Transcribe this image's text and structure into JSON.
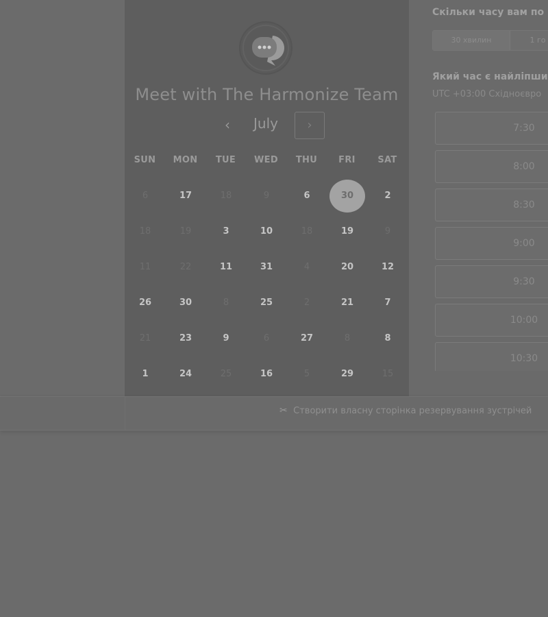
{
  "title": "Meet with The Harmonize Team",
  "calendar": {
    "month": "July",
    "prev_icon": "‹",
    "next_icon": "›",
    "weekdays": [
      "SUN",
      "MON",
      "TUE",
      "WED",
      "THU",
      "FRI",
      "SAT"
    ],
    "weeks": [
      [
        {
          "d": "6",
          "a": false
        },
        {
          "d": "17",
          "a": true
        },
        {
          "d": "18",
          "a": false
        },
        {
          "d": "9",
          "a": false
        },
        {
          "d": "6",
          "a": true
        },
        {
          "d": "30",
          "a": true,
          "s": true
        },
        {
          "d": "2",
          "a": true
        }
      ],
      [
        {
          "d": "18",
          "a": false
        },
        {
          "d": "19",
          "a": false
        },
        {
          "d": "3",
          "a": true
        },
        {
          "d": "10",
          "a": true
        },
        {
          "d": "18",
          "a": false
        },
        {
          "d": "19",
          "a": true
        },
        {
          "d": "9",
          "a": false
        }
      ],
      [
        {
          "d": "11",
          "a": false
        },
        {
          "d": "22",
          "a": false
        },
        {
          "d": "11",
          "a": true
        },
        {
          "d": "31",
          "a": true
        },
        {
          "d": "4",
          "a": false
        },
        {
          "d": "20",
          "a": true
        },
        {
          "d": "12",
          "a": true
        }
      ],
      [
        {
          "d": "26",
          "a": true
        },
        {
          "d": "30",
          "a": true
        },
        {
          "d": "8",
          "a": false
        },
        {
          "d": "25",
          "a": true
        },
        {
          "d": "2",
          "a": false
        },
        {
          "d": "21",
          "a": true
        },
        {
          "d": "7",
          "a": true
        }
      ],
      [
        {
          "d": "21",
          "a": false
        },
        {
          "d": "23",
          "a": true
        },
        {
          "d": "9",
          "a": true
        },
        {
          "d": "6",
          "a": false
        },
        {
          "d": "27",
          "a": true
        },
        {
          "d": "8",
          "a": false
        },
        {
          "d": "8",
          "a": true
        }
      ],
      [
        {
          "d": "1",
          "a": true
        },
        {
          "d": "24",
          "a": true
        },
        {
          "d": "25",
          "a": false
        },
        {
          "d": "16",
          "a": true
        },
        {
          "d": "5",
          "a": false
        },
        {
          "d": "29",
          "a": true
        },
        {
          "d": "15",
          "a": false
        }
      ]
    ]
  },
  "duration": {
    "question": "Скільки часу вам по",
    "options": [
      "30 хвилин",
      "1 го"
    ],
    "selected_index": 0
  },
  "time": {
    "question": "Який час є найліпши",
    "timezone": "UTC +03:00 Східноєвро",
    "slots": [
      "7:30",
      "8:00",
      "8:30",
      "9:00",
      "9:30",
      "10:00",
      "10:30"
    ]
  },
  "footer": {
    "link_icon": "✂",
    "link_text": "Створити власну сторінка резервування зустрічей"
  },
  "colors": {
    "overlay_background": "#6b6b6b",
    "card_background": "#5e5e5e",
    "selected_day": "#a3a3a3"
  }
}
